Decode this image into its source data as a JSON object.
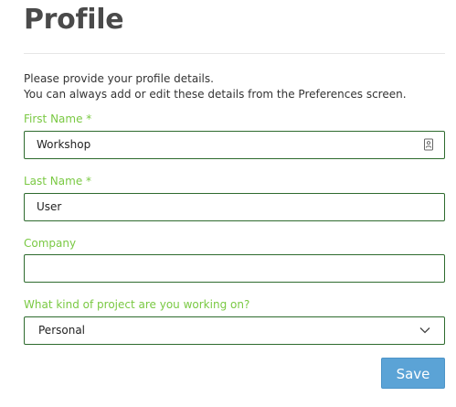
{
  "page": {
    "title": "Profile"
  },
  "intro": {
    "line1": "Please provide your profile details.",
    "line2": "You can always add or edit these details from the Preferences screen."
  },
  "form": {
    "first_name": {
      "label": "First Name *",
      "value": "Workshop",
      "icon": "contact-card-icon"
    },
    "last_name": {
      "label": "Last Name *",
      "value": "User"
    },
    "company": {
      "label": "Company",
      "value": ""
    },
    "project_kind": {
      "label": "What kind of project are you working on?",
      "selected": "Personal",
      "icon": "chevron-down-icon"
    },
    "save_label": "Save"
  },
  "colors": {
    "label_green": "#7ac943",
    "border_green": "#2e6b2e",
    "button_blue": "#5ba3d6",
    "title_gray": "#4a4a4a"
  }
}
